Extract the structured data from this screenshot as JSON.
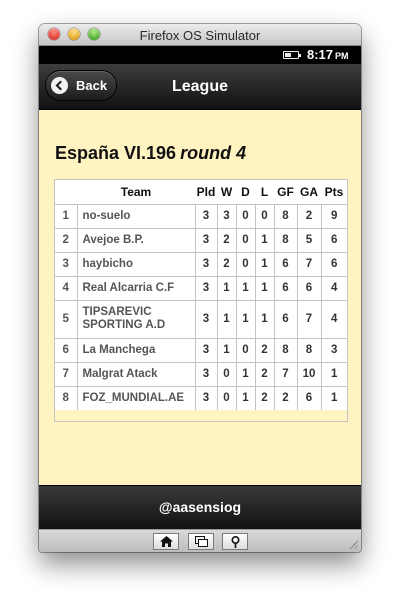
{
  "window": {
    "title": "Firefox OS Simulator"
  },
  "status_bar": {
    "time": "8:17",
    "ampm": "PM",
    "battery_level": 0.5
  },
  "header": {
    "back_label": "Back",
    "title": "League"
  },
  "league": {
    "name": "España VI.196",
    "round": "round 4",
    "columns": [
      "",
      "Team",
      "Pld",
      "W",
      "D",
      "L",
      "GF",
      "GA",
      "Pts"
    ],
    "rows": [
      [
        "1",
        "no-suelo",
        "3",
        "3",
        "0",
        "0",
        "8",
        "2",
        "9"
      ],
      [
        "2",
        "Avejoe B.P.",
        "3",
        "2",
        "0",
        "1",
        "8",
        "5",
        "6"
      ],
      [
        "3",
        "haybicho",
        "3",
        "2",
        "0",
        "1",
        "6",
        "7",
        "6"
      ],
      [
        "4",
        "Real Alcarria C.F",
        "3",
        "1",
        "1",
        "1",
        "6",
        "6",
        "4"
      ],
      [
        "5",
        "TIPSAREVIC SPORTING A.D",
        "3",
        "1",
        "1",
        "1",
        "6",
        "7",
        "4"
      ],
      [
        "6",
        "La Manchega",
        "3",
        "1",
        "0",
        "2",
        "8",
        "8",
        "3"
      ],
      [
        "7",
        "Malgrat Atack",
        "3",
        "0",
        "1",
        "2",
        "7",
        "10",
        "1"
      ],
      [
        "8",
        "FOZ_MUNDIAL.AE",
        "3",
        "0",
        "1",
        "2",
        "2",
        "6",
        "1"
      ]
    ]
  },
  "footer": {
    "text": "@aasensiog"
  },
  "bottom_nav": {
    "icons": [
      "home-icon",
      "windows-icon",
      "location-pin-icon"
    ]
  },
  "colors": {
    "content_bg": "#fff3c2",
    "bar_dark": "#111111"
  }
}
